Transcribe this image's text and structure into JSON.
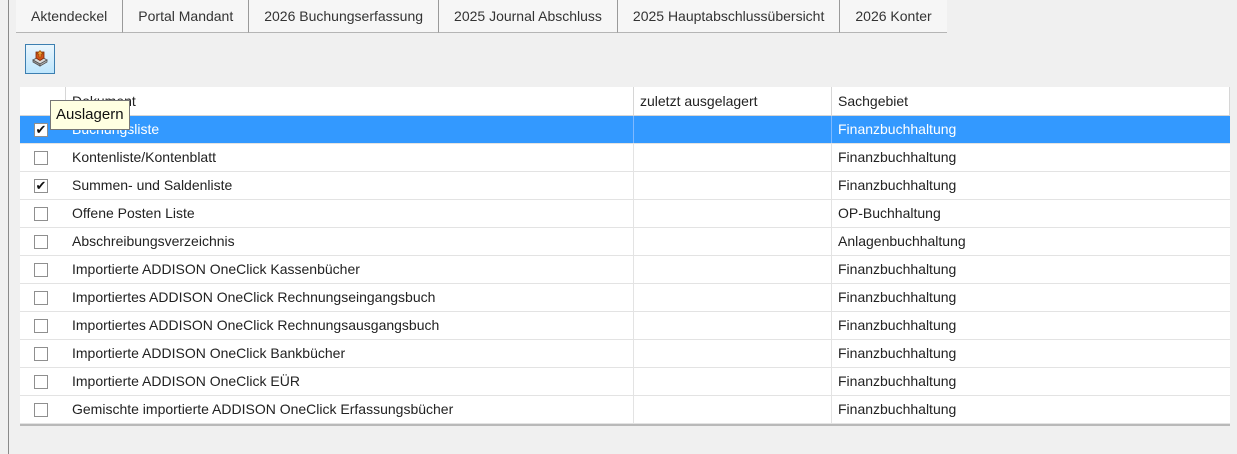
{
  "tabs": [
    {
      "label": "Aktendeckel"
    },
    {
      "label": "Portal Mandant"
    },
    {
      "label": "2026 Buchungserfassung"
    },
    {
      "label": "2025 Journal Abschluss"
    },
    {
      "label": "2025 Hauptabschlussübersicht"
    },
    {
      "label": "2026 Konter"
    }
  ],
  "toolbar": {
    "export_button_icon": "export-book-icon"
  },
  "tooltip": {
    "text": "Auslagern"
  },
  "grid": {
    "headers": {
      "document": "Dokument",
      "last_exported": "zuletzt ausgelagert",
      "subject": "Sachgebiet"
    },
    "rows": [
      {
        "checked": true,
        "document": "Buchungsliste",
        "last_exported": "",
        "subject": "Finanzbuchhaltung",
        "selected": true
      },
      {
        "checked": false,
        "document": "Kontenliste/Kontenblatt",
        "last_exported": "",
        "subject": "Finanzbuchhaltung",
        "selected": false
      },
      {
        "checked": true,
        "document": "Summen- und Saldenliste",
        "last_exported": "",
        "subject": "Finanzbuchhaltung",
        "selected": false
      },
      {
        "checked": false,
        "document": "Offene Posten Liste",
        "last_exported": "",
        "subject": "OP-Buchhaltung",
        "selected": false
      },
      {
        "checked": false,
        "document": "Abschreibungsverzeichnis",
        "last_exported": "",
        "subject": "Anlagenbuchhaltung",
        "selected": false
      },
      {
        "checked": false,
        "document": "Importierte ADDISON OneClick Kassenbücher",
        "last_exported": "",
        "subject": "Finanzbuchhaltung",
        "selected": false
      },
      {
        "checked": false,
        "document": "Importiertes ADDISON OneClick Rechnungseingangsbuch",
        "last_exported": "",
        "subject": "Finanzbuchhaltung",
        "selected": false
      },
      {
        "checked": false,
        "document": "Importiertes ADDISON OneClick Rechnungsausgangsbuch",
        "last_exported": "",
        "subject": "Finanzbuchhaltung",
        "selected": false
      },
      {
        "checked": false,
        "document": "Importierte ADDISON OneClick Bankbücher",
        "last_exported": "",
        "subject": "Finanzbuchhaltung",
        "selected": false
      },
      {
        "checked": false,
        "document": "Importierte ADDISON OneClick EÜR",
        "last_exported": "",
        "subject": "Finanzbuchhaltung",
        "selected": false
      },
      {
        "checked": false,
        "document": "Gemischte importierte ADDISON OneClick Erfassungsbücher",
        "last_exported": "",
        "subject": "Finanzbuchhaltung",
        "selected": false
      }
    ]
  }
}
